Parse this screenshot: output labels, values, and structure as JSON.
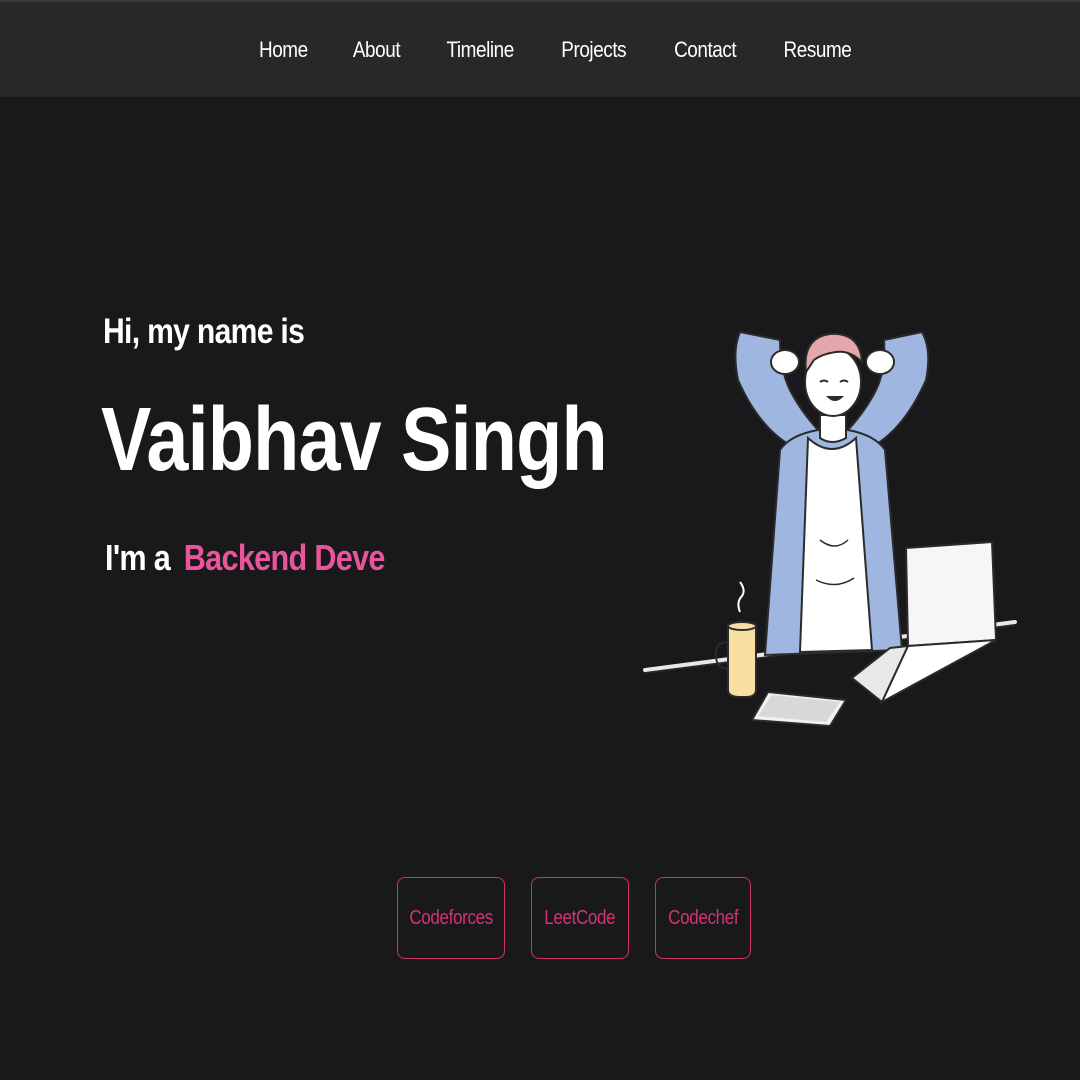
{
  "nav": {
    "items": [
      {
        "label": "Home"
      },
      {
        "label": "About"
      },
      {
        "label": "Timeline"
      },
      {
        "label": "Projects"
      },
      {
        "label": "Contact"
      },
      {
        "label": "Resume"
      }
    ]
  },
  "hero": {
    "greeting": "Hi, my name is",
    "name": "Vaibhav Singh",
    "role_prefix": "I'm a",
    "role_text": "Backend Deve",
    "illustration": "developer-relaxing-at-laptop-illustration"
  },
  "profiles": {
    "buttons": [
      {
        "label": "Codeforces"
      },
      {
        "label": "LeetCode"
      },
      {
        "label": "Codechef"
      }
    ]
  },
  "colors": {
    "background": "#19191b",
    "navbar": "#28282a",
    "accent": "#e8559a",
    "button_border": "#d0306a"
  }
}
